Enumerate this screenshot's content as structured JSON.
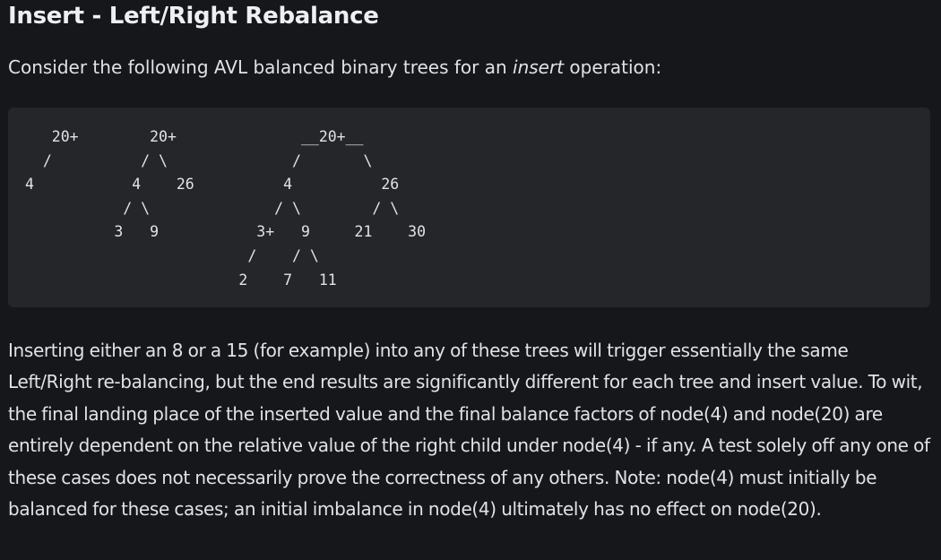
{
  "heading": "Insert - Left/Right Rebalance",
  "intro": {
    "before": "Consider the following AVL balanced binary trees for an ",
    "emphasis": "insert",
    "after": " operation:"
  },
  "code": "   20+        20+              __20+__\n  /          / \\              /       \\\n4           4    26          4          26\n           / \\              / \\        / \\\n          3   9           3+   9     21    30\n                         /    / \\\n                        2    7   11",
  "paragraph": "Inserting either an 8 or a 15 (for example) into any of these trees will trigger essentially the same Left/Right re-balancing, but the end results are significantly different for each tree and insert value. To wit, the final landing place of the inserted value and the final balance factors of node(4) and node(20) are entirely dependent on the relative value of the right child under node(4) - if any. A test solely off any one of these cases does not necessarily prove the correctness of any others. Note: node(4) must initially be balanced for these cases; an initial imbalance in node(4) ultimately has no effect on node(20)."
}
